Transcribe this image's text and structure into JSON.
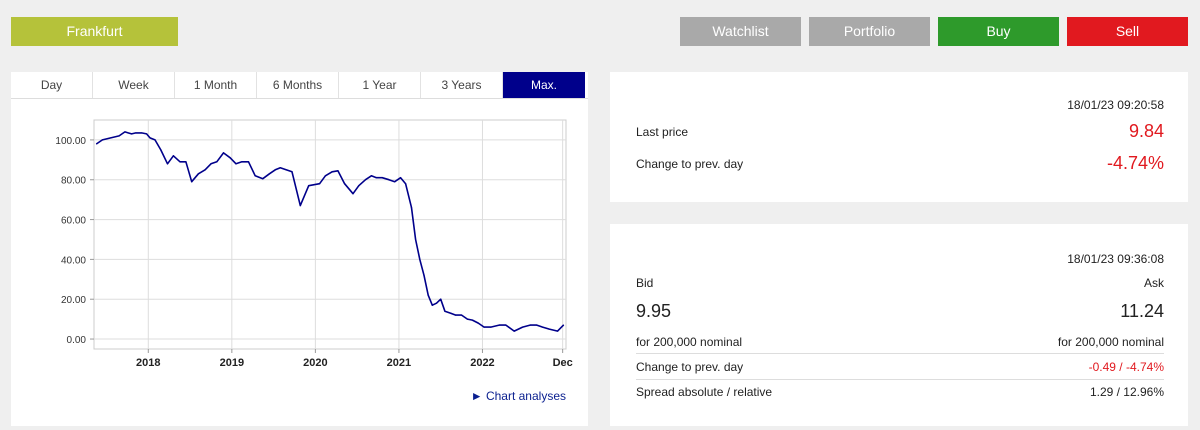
{
  "topbar": {
    "exchange_label": "Frankfurt",
    "watchlist_label": "Watchlist",
    "portfolio_label": "Portfolio",
    "buy_label": "Buy",
    "sell_label": "Sell"
  },
  "tabs": [
    "Day",
    "Week",
    "1 Month",
    "6 Months",
    "1 Year",
    "3 Years",
    "Max."
  ],
  "active_tab": "Max.",
  "chart_link_label": "Chart analyses",
  "price_panel": {
    "timestamp": "18/01/23 09:20:58",
    "last_price_label": "Last price",
    "last_price_value": "9.84",
    "change_label": "Change to prev. day",
    "change_value": "-4.74%"
  },
  "quote_panel": {
    "timestamp": "18/01/23 09:36:08",
    "bid_label": "Bid",
    "ask_label": "Ask",
    "bid_value": "9.95",
    "ask_value": "11.24",
    "bid_nominal": "for 200,000 nominal",
    "ask_nominal": "for 200,000 nominal",
    "change_label": "Change to prev. day",
    "change_value": "-0.49 / -4.74%",
    "spread_label": "Spread absolute / relative",
    "spread_value": "1.29 / 12.96%"
  },
  "colors": {
    "accent_green": "#b5c23a",
    "buy": "#2e9a2b",
    "sell": "#e1191f",
    "tab_active": "#00008b",
    "line": "#00008b"
  },
  "chart_data": {
    "type": "line",
    "ylim": [
      -5,
      110
    ],
    "yticks": [
      0,
      20,
      40,
      60,
      80,
      100
    ],
    "ytick_labels": [
      "0.00",
      "20.00",
      "40.00",
      "60.00",
      "80.00",
      "100.00"
    ],
    "xlim": [
      2017.35,
      2023.0
    ],
    "xticks": [
      2018,
      2019,
      2020,
      2021,
      2022,
      2022.96
    ],
    "xtick_labels": [
      "2018",
      "2019",
      "2020",
      "2021",
      "2022",
      "Dec"
    ],
    "grid": true,
    "x": [
      2017.38,
      2017.45,
      2017.55,
      2017.65,
      2017.72,
      2017.8,
      2017.85,
      2017.92,
      2017.98,
      2018.02,
      2018.08,
      2018.15,
      2018.23,
      2018.3,
      2018.38,
      2018.45,
      2018.52,
      2018.6,
      2018.68,
      2018.75,
      2018.82,
      2018.9,
      2018.98,
      2019.05,
      2019.12,
      2019.2,
      2019.28,
      2019.37,
      2019.45,
      2019.52,
      2019.58,
      2019.65,
      2019.72,
      2019.82,
      2019.92,
      2020.05,
      2020.12,
      2020.2,
      2020.27,
      2020.35,
      2020.45,
      2020.52,
      2020.6,
      2020.67,
      2020.73,
      2020.8,
      2020.88,
      2020.95,
      2021.02,
      2021.08,
      2021.15,
      2021.2,
      2021.25,
      2021.3,
      2021.35,
      2021.4,
      2021.45,
      2021.5,
      2021.55,
      2021.62,
      2021.68,
      2021.75,
      2021.82,
      2021.88,
      2021.95,
      2022.02,
      2022.1,
      2022.2,
      2022.28,
      2022.38,
      2022.48,
      2022.57,
      2022.65,
      2022.72,
      2022.8,
      2022.9,
      2022.97
    ],
    "y": [
      98,
      100,
      101,
      102,
      104,
      103,
      103.5,
      103.5,
      103,
      101,
      100,
      95,
      88,
      92,
      89,
      89,
      79,
      83,
      85,
      88,
      89,
      93.5,
      91,
      88,
      89,
      89,
      82,
      80.5,
      83,
      85,
      86,
      85,
      84,
      67,
      77,
      78,
      82,
      84,
      84.5,
      78,
      73,
      77,
      80,
      82,
      81,
      81,
      80,
      79,
      81,
      78,
      66,
      50,
      40,
      32,
      22,
      17,
      18,
      20,
      14,
      13,
      12,
      12,
      10,
      9.5,
      8,
      6,
      6,
      7,
      7,
      4,
      6,
      7,
      7,
      6,
      5,
      4,
      7
    ]
  }
}
